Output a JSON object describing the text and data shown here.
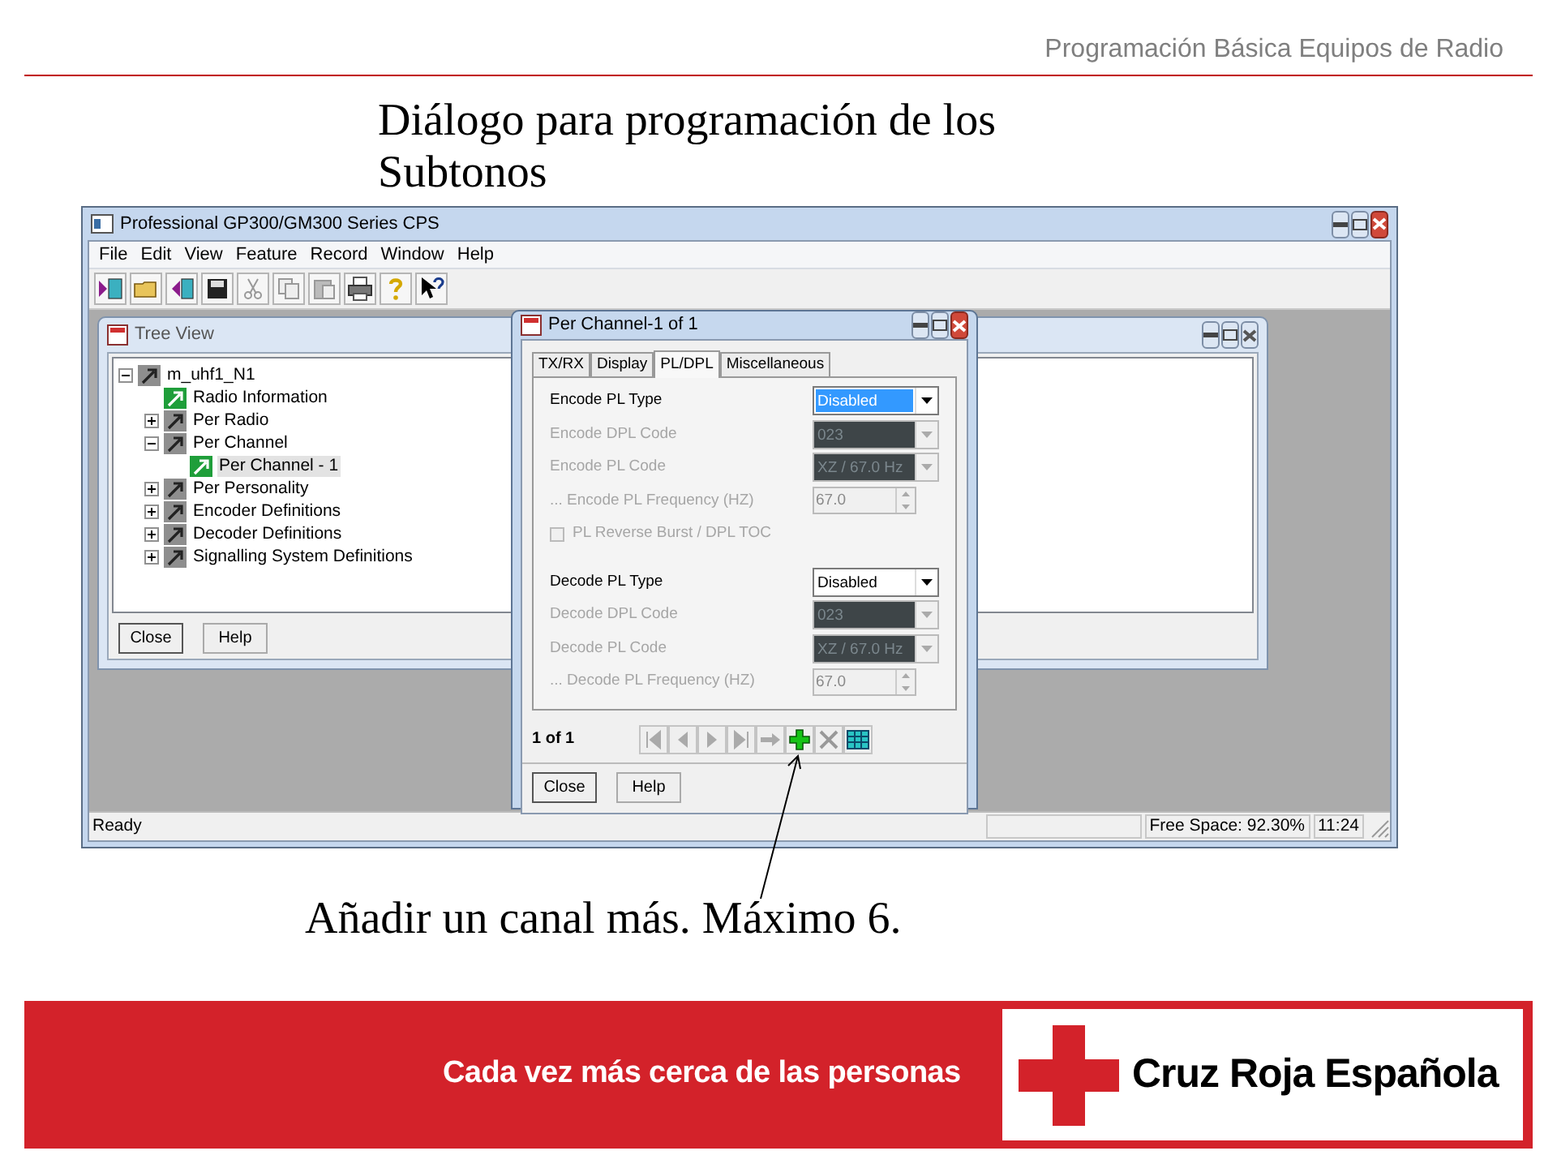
{
  "slide": {
    "header": "Programación Básica Equipos de Radio",
    "title": "Diálogo para programación de los Subtonos",
    "caption": "Añadir un canal más. Máximo 6.",
    "footer": {
      "slogan": "Cada vez más cerca de las personas",
      "brand": "Cruz Roja Española"
    }
  },
  "app": {
    "title": "Professional GP300/GM300 Series CPS",
    "menu": [
      "File",
      "Edit",
      "View",
      "Feature",
      "Record",
      "Window",
      "Help"
    ],
    "tree_view": {
      "title": "Tree View",
      "tree": [
        {
          "label": "m_uhf1_N1",
          "kind": "folder",
          "selected": false,
          "expanded": true,
          "children": [
            {
              "label": "Radio Information",
              "kind": "record",
              "selected": false
            },
            {
              "label": "Per Radio",
              "kind": "folder",
              "selected": false,
              "expanded": false
            },
            {
              "label": "Per Channel",
              "kind": "folder",
              "selected": false,
              "expanded": true,
              "children": [
                {
                  "label": "Per Channel - 1",
                  "kind": "record",
                  "selected": true
                }
              ]
            },
            {
              "label": "Per Personality",
              "kind": "folder",
              "selected": false,
              "expanded": false
            },
            {
              "label": "Encoder Definitions",
              "kind": "folder",
              "selected": false,
              "expanded": false
            },
            {
              "label": "Decoder Definitions",
              "kind": "folder",
              "selected": false,
              "expanded": false
            },
            {
              "label": "Signalling System Definitions",
              "kind": "folder",
              "selected": false,
              "expanded": false
            }
          ]
        }
      ],
      "buttons": [
        "Close",
        "Help"
      ]
    },
    "dialog": {
      "title": "Per Channel-1 of 1",
      "tabs": [
        {
          "label": "TX/RX",
          "selected": false
        },
        {
          "label": "Display",
          "selected": false
        },
        {
          "label": "PL/DPL",
          "selected": true
        },
        {
          "label": "Miscellaneous",
          "selected": false
        }
      ],
      "sections": [
        [
          {
            "kind": "dropdown",
            "label": "Encode PL Type",
            "value": "Disabled",
            "disabled": false,
            "highlighted": true
          },
          {
            "kind": "dropdown",
            "label": "Encode DPL Code",
            "value": "023",
            "disabled": true
          },
          {
            "kind": "dropdown",
            "label": "Encode PL Code",
            "value": "XZ / 67.0 Hz",
            "disabled": true
          },
          {
            "kind": "spin",
            "label": "... Encode PL Frequency (HZ)",
            "value": "67.0",
            "disabled": true
          },
          {
            "kind": "checkbox",
            "label": "PL Reverse Burst / DPL TOC",
            "checked": false,
            "disabled": true
          }
        ],
        [
          {
            "kind": "dropdown",
            "label": "Decode PL Type",
            "value": "Disabled",
            "disabled": false,
            "highlighted": false
          },
          {
            "kind": "dropdown",
            "label": "Decode DPL Code",
            "value": "023",
            "disabled": true
          },
          {
            "kind": "dropdown",
            "label": "Decode PL Code",
            "value": "XZ / 67.0 Hz",
            "disabled": true
          },
          {
            "kind": "spin",
            "label": "... Decode PL Frequency (HZ)",
            "value": "67.0",
            "disabled": true
          }
        ]
      ],
      "pager": "1 of 1",
      "buttons": [
        "Close",
        "Help"
      ]
    },
    "status_bar": {
      "text": "Ready",
      "free_space": "Free Space: 92.30%",
      "time": "11:24"
    }
  }
}
